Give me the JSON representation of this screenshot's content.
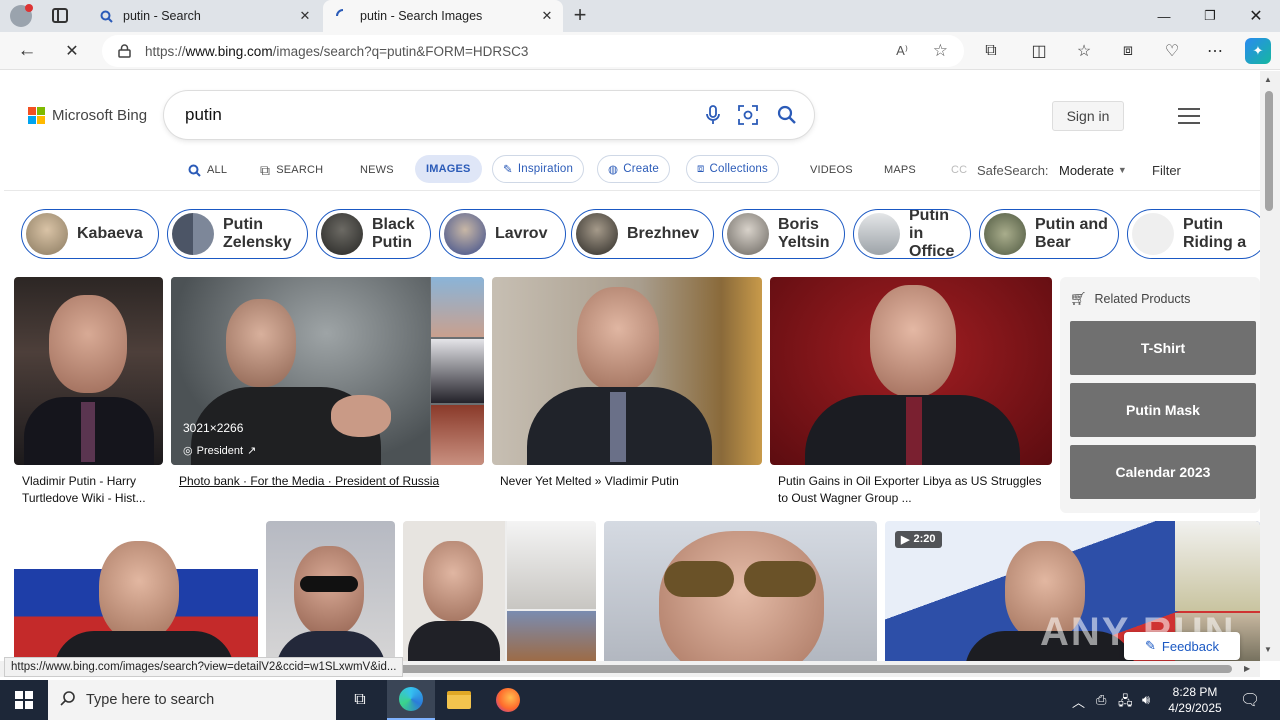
{
  "browser": {
    "tabs": [
      {
        "title": "putin - Search",
        "active": false
      },
      {
        "title": "putin - Search Images",
        "active": true
      }
    ],
    "url_prefix": "https://",
    "url_domain": "www.bing.com",
    "url_rest": "/images/search?q=putin&FORM=HDRSC3",
    "status_url": "https://www.bing.com/images/search?view=detailV2&ccid=w1SLxwmV&id..."
  },
  "bing": {
    "logo_text": "Microsoft Bing",
    "query": "putin",
    "sign_in": "Sign in",
    "nav": {
      "all": "ALL",
      "search": "SEARCH",
      "news": "NEWS",
      "images": "IMAGES",
      "inspiration": "Inspiration",
      "create": "Create",
      "collections": "Collections",
      "videos": "VIDEOS",
      "maps": "MAPS",
      "more": "CC",
      "safesearch_label": "SafeSearch:",
      "safesearch_value": "Moderate",
      "filter": "Filter"
    },
    "chips": [
      {
        "label": "Kabaeva",
        "color": "#a89a84"
      },
      {
        "label": "Putin Zelensky",
        "color": "#5a6270"
      },
      {
        "label": "Black Putin",
        "color": "#3a3a38"
      },
      {
        "label": "Lavrov",
        "color": "#6a7690"
      },
      {
        "label": "Brezhnev",
        "color": "#4c4a44"
      },
      {
        "label": "Boris Yeltsin",
        "color": "#b9b6b0"
      },
      {
        "label": "Putin in Office",
        "color": "#c2c6c8"
      },
      {
        "label": "Putin and Bear",
        "color": "#7a8464"
      },
      {
        "label": "Putin Riding a",
        "color": "#eaeaea"
      }
    ],
    "results": [
      {
        "caption": "Vladimir Putin - Harry Turtledove Wiki - Hist...",
        "color": "#3c3532"
      },
      {
        "caption": "Photo bank · For the Media · President of Russia",
        "size": "3021×2266",
        "source": "President",
        "color": "#6b6f72"
      },
      {
        "caption": "Never Yet Melted » Vladimir Putin",
        "color": "#a59b8d"
      },
      {
        "caption": "Putin Gains in Oil Exporter Libya as US Struggles to Oust Wagner Group ...",
        "color": "#7a1418"
      }
    ],
    "video_duration": "2:20",
    "related": {
      "title": "Related Products",
      "items": [
        "T-Shirt",
        "Putin Mask",
        "Calendar 2023"
      ]
    },
    "feedback": "Feedback",
    "watermark": "ANY RUN"
  },
  "taskbar": {
    "search_placeholder": "Type here to search",
    "time": "8:28 PM",
    "date": "4/29/2025"
  }
}
